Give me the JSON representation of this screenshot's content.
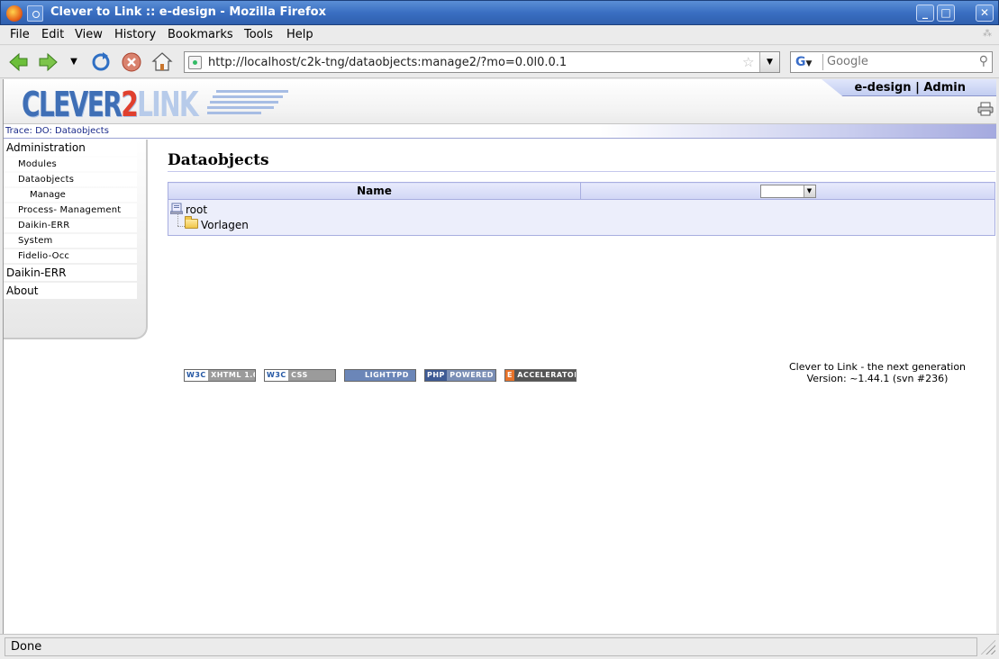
{
  "window": {
    "title": "Clever to Link :: e-design - Mozilla Firefox"
  },
  "menu": {
    "file": "File",
    "edit": "Edit",
    "view": "View",
    "history": "History",
    "bookmarks": "Bookmarks",
    "tools": "Tools",
    "help": "Help"
  },
  "navigation": {
    "url": "http://localhost/c2k-tng/dataobjects:manage2/?mo=0.0l0.0.1",
    "search_placeholder": "Google"
  },
  "header": {
    "logo_a": "CLEVER",
    "logo_b": "2",
    "logo_c": "LINK",
    "company": "e-design",
    "separator": "|",
    "user": "Admin"
  },
  "trace": "Trace: DO: Dataobjects",
  "sidebar": {
    "items": [
      {
        "label": "Administration",
        "level": 1
      },
      {
        "label": "Modules",
        "level": 2
      },
      {
        "label": "Dataobjects",
        "level": 2
      },
      {
        "label": "Manage",
        "level": 3
      },
      {
        "label": "Process- Management",
        "level": 2
      },
      {
        "label": "Daikin-ERR",
        "level": 2
      },
      {
        "label": "System",
        "level": 2
      },
      {
        "label": "Fidelio-Occ",
        "level": 2
      },
      {
        "label": "Daikin-ERR",
        "level": 1
      },
      {
        "label": "About",
        "level": 1
      }
    ]
  },
  "main": {
    "title": "Dataobjects",
    "table": {
      "column_name": "Name",
      "tree": {
        "root": "root",
        "child": "Vorlagen"
      }
    }
  },
  "footer": {
    "badges": {
      "xhtml_a": "W3C",
      "xhtml_b": "XHTML 1.0",
      "css_a": "W3C",
      "css_b": "CSS",
      "lighttpd": "LIGHTTPD",
      "php_a": "PHP",
      "php_b": "POWERED",
      "eacc_a": "E",
      "eacc_b": "ACCELERATOR"
    },
    "tagline": "Clever to Link - the next generation",
    "version": "Version: ~1.44.1 (svn #236)"
  },
  "status": "Done",
  "colors": {
    "accent": "#3f6fb6",
    "logo_red": "#e0402e",
    "table_border": "#a8aee0"
  }
}
